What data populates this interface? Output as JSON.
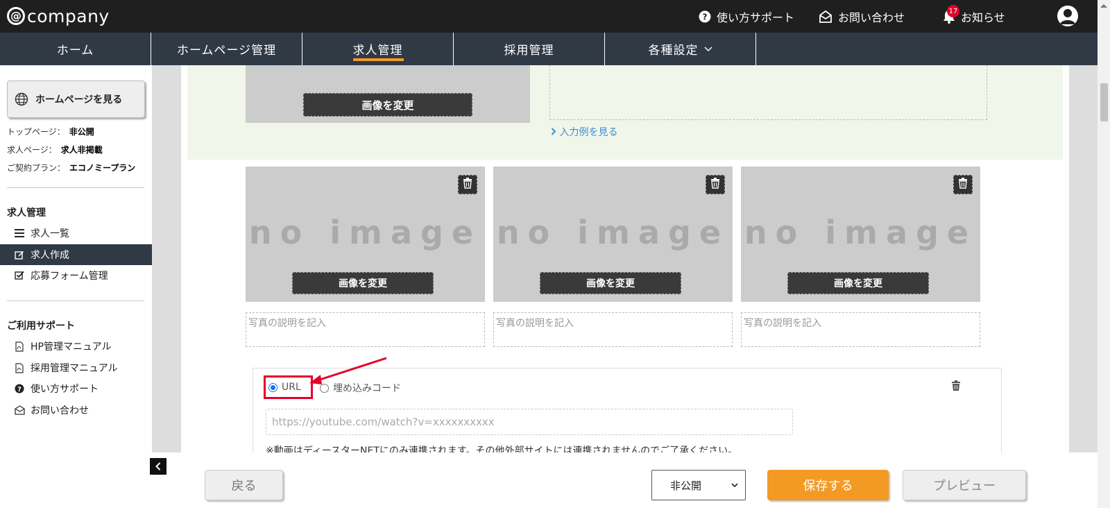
{
  "header": {
    "logo_at": "@",
    "logo_text": "company",
    "support_label": "使い方サポート",
    "contact_label": "お問い合わせ",
    "notice_label": "お知らせ",
    "notice_count": "17"
  },
  "nav": {
    "items": [
      {
        "label": "ホーム"
      },
      {
        "label": "ホームページ管理"
      },
      {
        "label": "求人管理"
      },
      {
        "label": "採用管理"
      },
      {
        "label": "各種設定"
      }
    ]
  },
  "sidebar": {
    "view_site_label": "ホームページを見る",
    "info": [
      {
        "label": "トップページ：",
        "value": "非公開"
      },
      {
        "label": "求人ページ：",
        "value": "求人非掲載"
      },
      {
        "label": "ご契約プラン：",
        "value": "エコノミープラン"
      }
    ],
    "section1_title": "求人管理",
    "section1_items": [
      {
        "label": "求人一覧"
      },
      {
        "label": "求人作成"
      },
      {
        "label": "応募フォーム管理"
      }
    ],
    "section2_title": "ご利用サポート",
    "section2_items": [
      {
        "label": "HP管理マニュアル"
      },
      {
        "label": "採用管理マニュアル"
      },
      {
        "label": "使い方サポート"
      },
      {
        "label": "お問い合わせ"
      }
    ]
  },
  "main": {
    "top_change_label": "画像を変更",
    "example_link": "入力例を見る",
    "cards": [
      {
        "noimage": "no image",
        "change_label": "画像を変更",
        "caption_placeholder": "写真の説明を記入"
      },
      {
        "noimage": "no image",
        "change_label": "画像を変更",
        "caption_placeholder": "写真の説明を記入"
      },
      {
        "noimage": "no image",
        "change_label": "画像を変更",
        "caption_placeholder": "写真の説明を記入"
      }
    ],
    "video": {
      "radio_url": "URL",
      "radio_embed": "埋め込みコード",
      "url_placeholder": "https://youtube.com/watch?v=xxxxxxxxxx",
      "note": "※動画はディースターNETにのみ連携されます。その他外部サイトには連携されませんのでご了承ください。"
    }
  },
  "footer": {
    "back_label": "戻る",
    "status_value": "非公開",
    "save_label": "保存する",
    "preview_label": "プレビュー"
  },
  "colors": {
    "accent": "#f39a25",
    "nav_bg": "#2f3a45",
    "highlight": "#e4002b"
  }
}
